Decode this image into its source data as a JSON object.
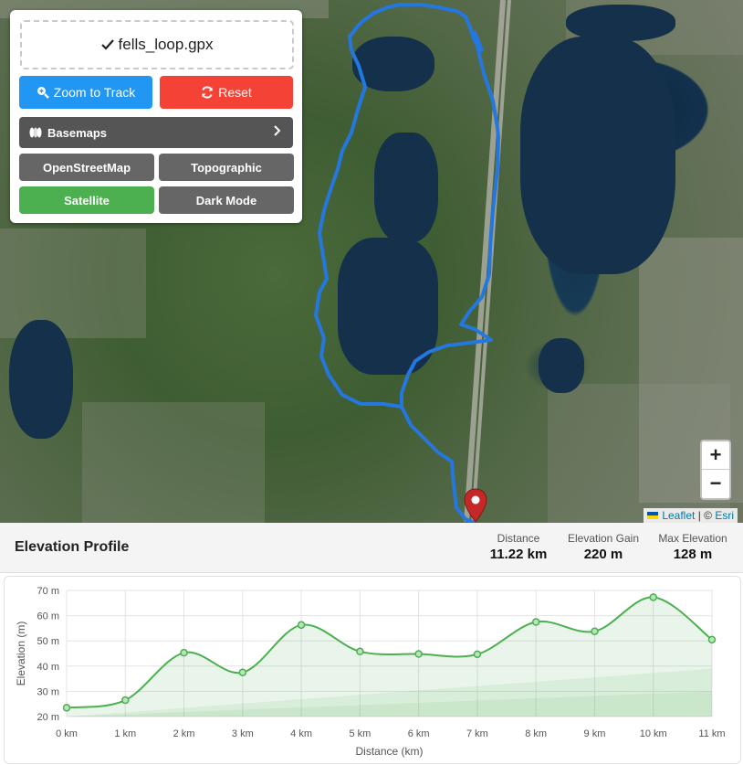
{
  "panel": {
    "file_name": "fells_loop.gpx",
    "zoom_button": "Zoom to Track",
    "reset_button": "Reset",
    "basemaps_label": "Basemaps",
    "basemap_options": [
      "OpenStreetMap",
      "Topographic",
      "Satellite",
      "Dark Mode"
    ],
    "active_basemap": "Satellite"
  },
  "map": {
    "zoom_in": "+",
    "zoom_out": "−",
    "attribution_link": "Leaflet",
    "attribution_sep": " | © ",
    "attribution_source": "Esri",
    "track_color": "#2577e0",
    "marker_color": "#c62828"
  },
  "elevation": {
    "title": "Elevation Profile",
    "stats": [
      {
        "label": "Distance",
        "value": "11.22 km"
      },
      {
        "label": "Elevation Gain",
        "value": "220 m"
      },
      {
        "label": "Max Elevation",
        "value": "128 m"
      }
    ]
  },
  "chart_data": {
    "type": "area",
    "title": "",
    "xlabel": "Distance (km)",
    "ylabel": "Elevation (m)",
    "xlim": [
      0,
      11
    ],
    "ylim": [
      20,
      70
    ],
    "x_ticks": [
      0,
      1,
      2,
      3,
      4,
      5,
      6,
      7,
      8,
      9,
      10,
      11
    ],
    "x_tick_labels": [
      "0 km",
      "1 km",
      "2 km",
      "3 km",
      "4 km",
      "5 km",
      "6 km",
      "7 km",
      "8 km",
      "9 km",
      "10 km",
      "11 km"
    ],
    "y_ticks": [
      20,
      30,
      40,
      50,
      60,
      70
    ],
    "y_tick_labels": [
      "20 m",
      "30 m",
      "40 m",
      "50 m",
      "60 m",
      "70 m"
    ],
    "grid": true,
    "series": [
      {
        "x": [
          0,
          1,
          2,
          3,
          4,
          5,
          6,
          7,
          8,
          9,
          10,
          11
        ],
        "y": [
          23.5,
          26.5,
          45.3,
          37.5,
          56.3,
          45.8,
          44.8,
          44.7,
          57.5,
          53.8,
          67.3,
          50.5
        ],
        "color": "#4caf50"
      }
    ]
  }
}
